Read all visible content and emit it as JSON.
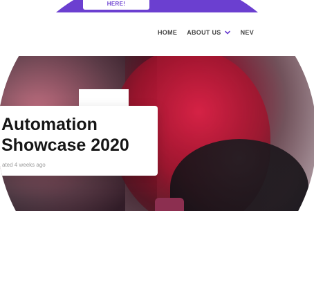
{
  "banner": {
    "text": "HERE!"
  },
  "nav": {
    "items": [
      {
        "label": "HOME",
        "has_dropdown": false
      },
      {
        "label": "ABOUT US",
        "has_dropdown": true
      },
      {
        "label": "NEV",
        "has_dropdown": false
      }
    ]
  },
  "hero": {
    "accent_colors": [
      "#a1314a",
      "#6b3fd0"
    ]
  },
  "card": {
    "title": "Automation Showcase 2020",
    "meta": "ated 4 weeks ago"
  },
  "bottom": {
    "partial_heading": ""
  }
}
